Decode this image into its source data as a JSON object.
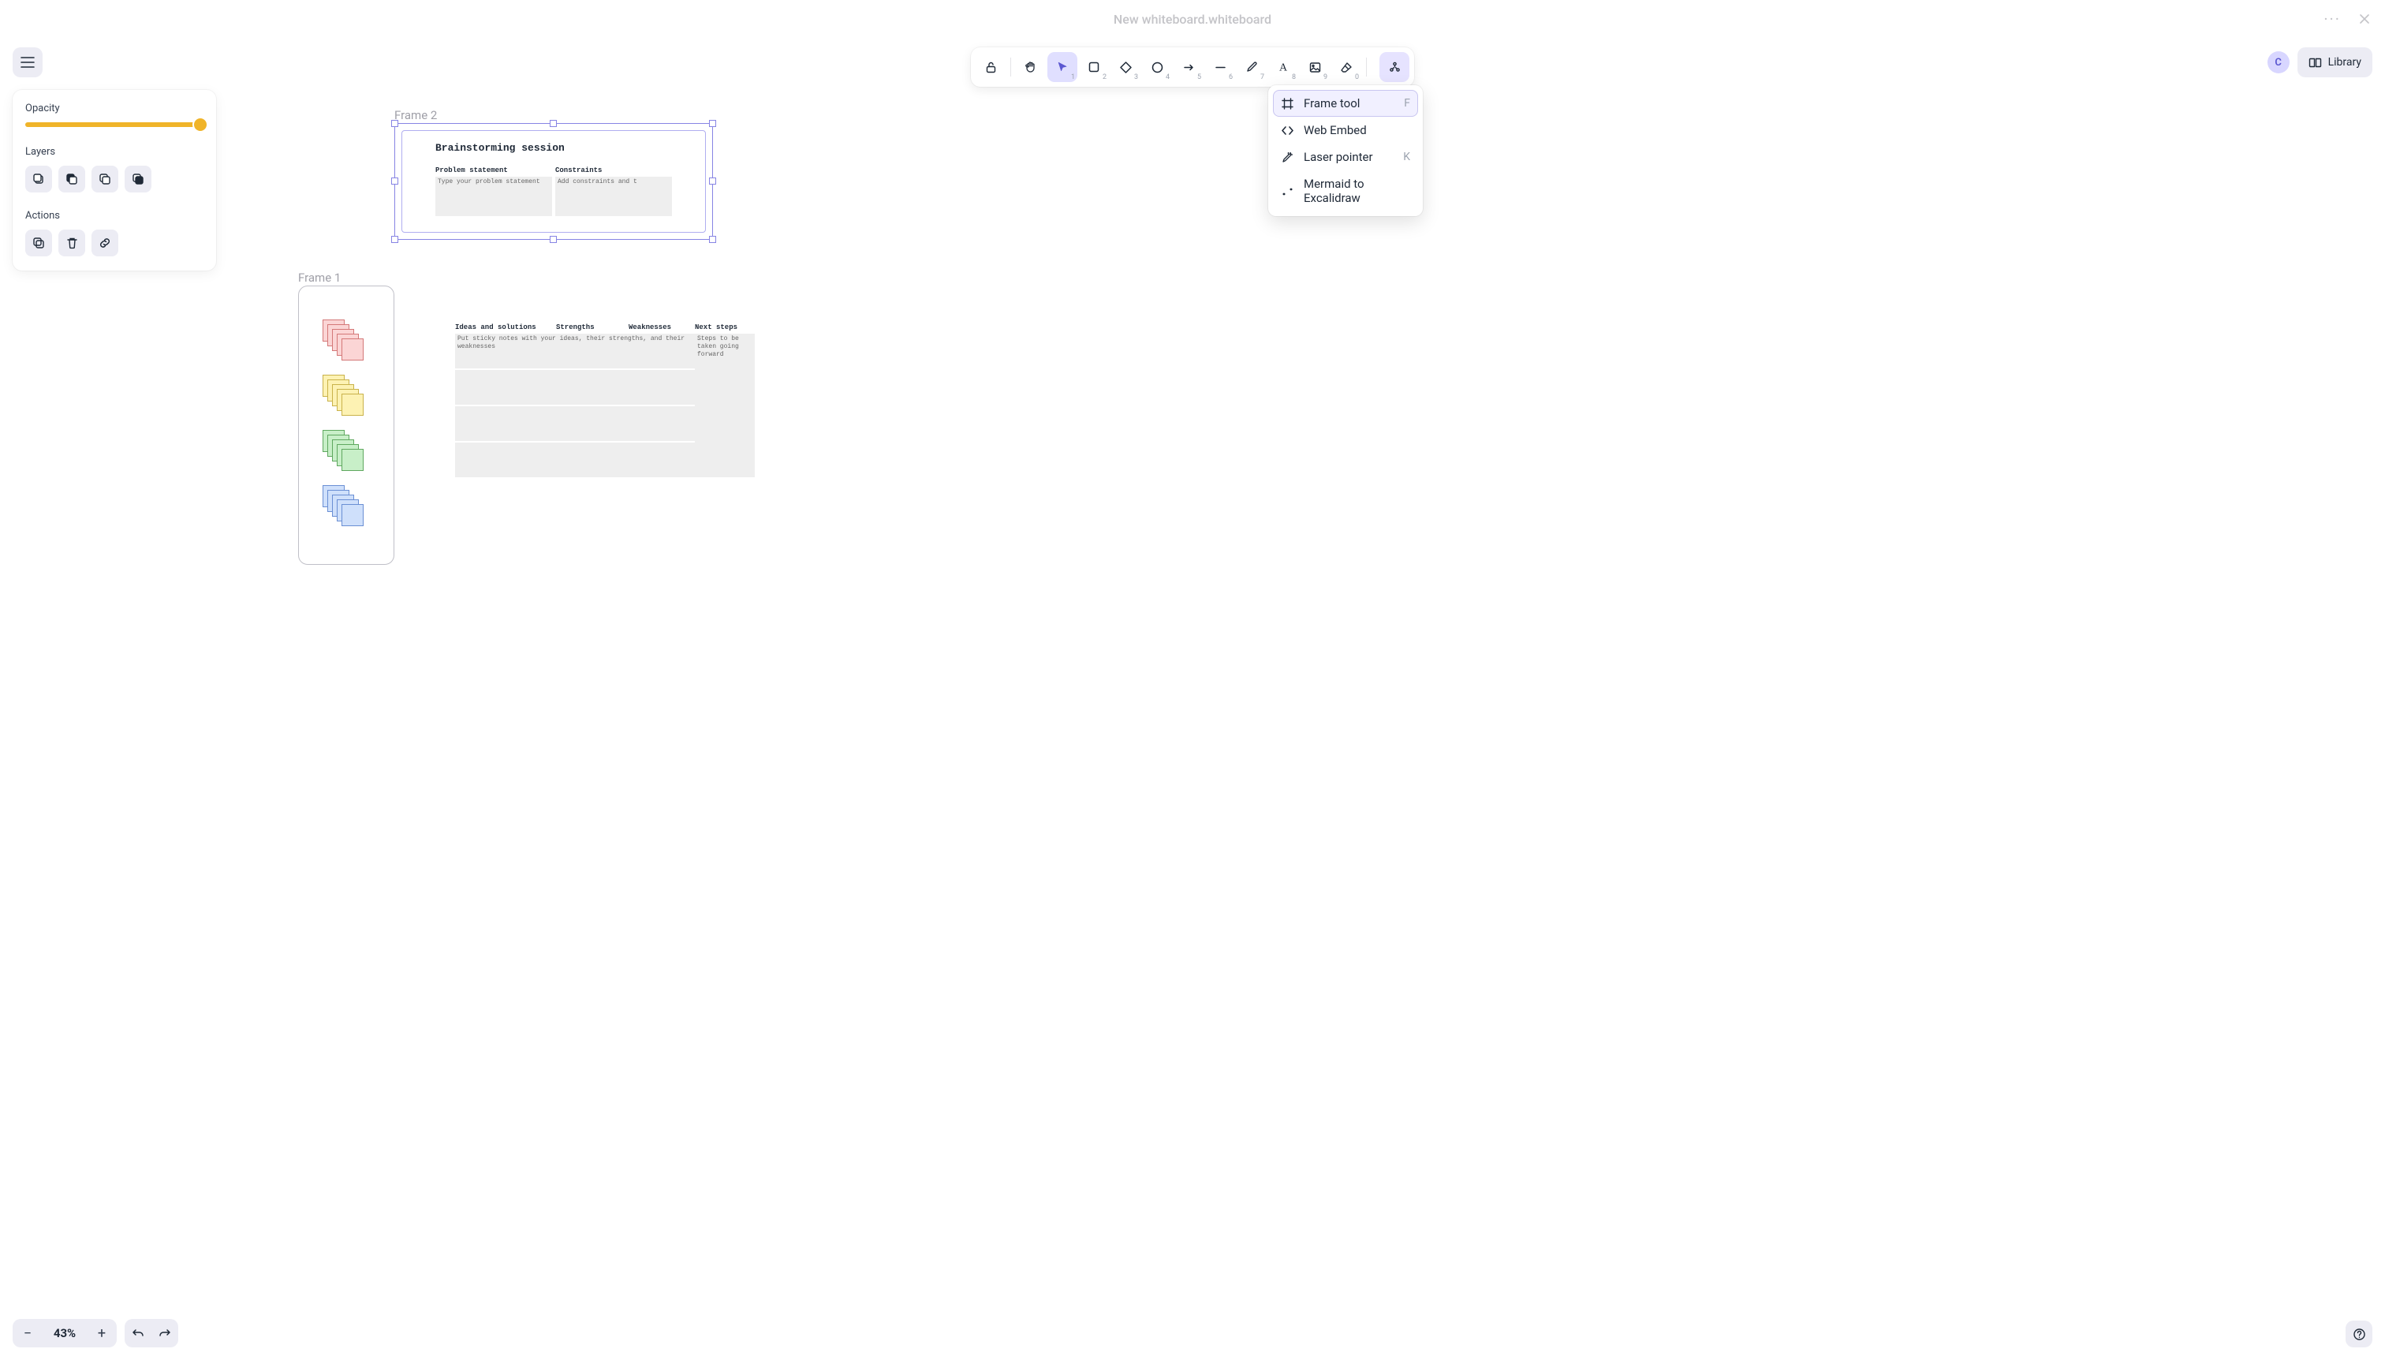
{
  "tabbar": {
    "title": "New whiteboard.whiteboard"
  },
  "avatar_initial": "C",
  "library_label": "Library",
  "panel": {
    "opacity_label": "Opacity",
    "layers_label": "Layers",
    "actions_label": "Actions",
    "opacity_value": 100
  },
  "toolbar": {
    "lock": "Lock",
    "hand": "Hand",
    "select": "Selection",
    "rect": "Rectangle",
    "diamond": "Diamond",
    "ellipse": "Ellipse",
    "arrow": "Arrow",
    "line": "Line",
    "draw": "Draw",
    "text": "Text",
    "image": "Image",
    "eraser": "Eraser",
    "more": "More tools"
  },
  "dropdown": {
    "items": [
      {
        "label": "Frame tool",
        "key": "F",
        "selected": true
      },
      {
        "label": "Web Embed",
        "key": "",
        "selected": false
      },
      {
        "label": "Laser pointer",
        "key": "K",
        "selected": false
      },
      {
        "label": "Mermaid to Excalidraw",
        "key": "",
        "selected": false
      }
    ]
  },
  "zoom": {
    "level": "43%"
  },
  "canvas": {
    "frame2": {
      "label": "Frame 2",
      "title": "Brainstorming session",
      "cols": [
        {
          "header": "Problem statement",
          "placeholder": "Type your problem statement"
        },
        {
          "header": "Constraints",
          "placeholder": "Add constraints and t"
        }
      ]
    },
    "frame1": {
      "label": "Frame 1",
      "sticky_colors": [
        "pink",
        "yellow",
        "green",
        "blue"
      ]
    },
    "grid": {
      "headers": [
        "Ideas and solutions",
        "Strengths",
        "Weaknesses",
        "Next steps"
      ],
      "row1_text": "Put sticky notes with your ideas, their strengths, and their weaknesses",
      "right_text": "Steps to be taken going forward"
    }
  }
}
